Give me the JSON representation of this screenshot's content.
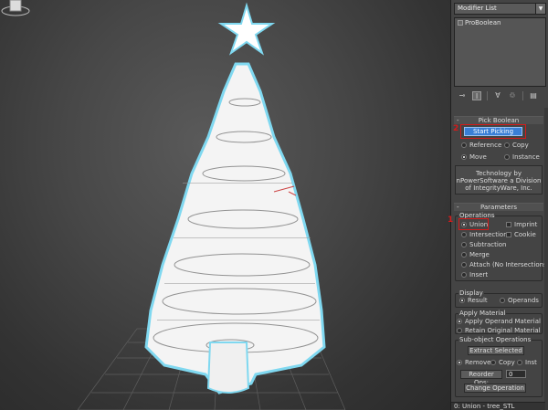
{
  "modifier_list": {
    "label": "Modifier List"
  },
  "stack": {
    "items": [
      "ProBoolean"
    ]
  },
  "toolbar": {
    "icons": [
      "pin-stack-icon",
      "show-end-result-icon",
      "make-unique-icon",
      "remove-modifier-icon",
      "configure-sets-icon"
    ]
  },
  "pick_boolean": {
    "header": "Pick Boolean",
    "start_picking": "Start Picking",
    "options": [
      {
        "label": "Reference",
        "selected": false
      },
      {
        "label": "Copy",
        "selected": false
      },
      {
        "label": "Move",
        "selected": true
      },
      {
        "label": "Instance",
        "selected": false
      }
    ],
    "tech_line1": "Technology by",
    "tech_line2": "nPowerSoftware a Division",
    "tech_line3": "of IntegrityWare, Inc."
  },
  "parameters": {
    "header": "Parameters",
    "operations_title": "Operations",
    "operations": [
      {
        "label": "Union",
        "selected": true
      },
      {
        "label": "Intersection",
        "selected": false
      },
      {
        "label": "Subtraction",
        "selected": false
      },
      {
        "label": "Merge",
        "selected": false
      },
      {
        "label": "Attach (No Intersections)",
        "selected": false
      },
      {
        "label": "Insert",
        "selected": false
      }
    ],
    "imprint": "Imprint",
    "cookie": "Cookie",
    "display_title": "Display",
    "display_result": "Result",
    "display_operands": "Operands",
    "apply_material_title": "Apply Material",
    "apply_operand": "Apply Operand Material",
    "retain_original": "Retain Original Material",
    "subobject_title": "Sub-object Operations",
    "extract_selected": "Extract Selected",
    "remove": "Remove",
    "copy": "Copy",
    "inst": "Inst",
    "reorder_ops": "Reorder Ops:",
    "reorder_value": "0",
    "change_operation": "Change Operation"
  },
  "annotations": {
    "num1": "1",
    "num2": "2"
  },
  "footer": {
    "text": "0: Union - tree_STL"
  }
}
